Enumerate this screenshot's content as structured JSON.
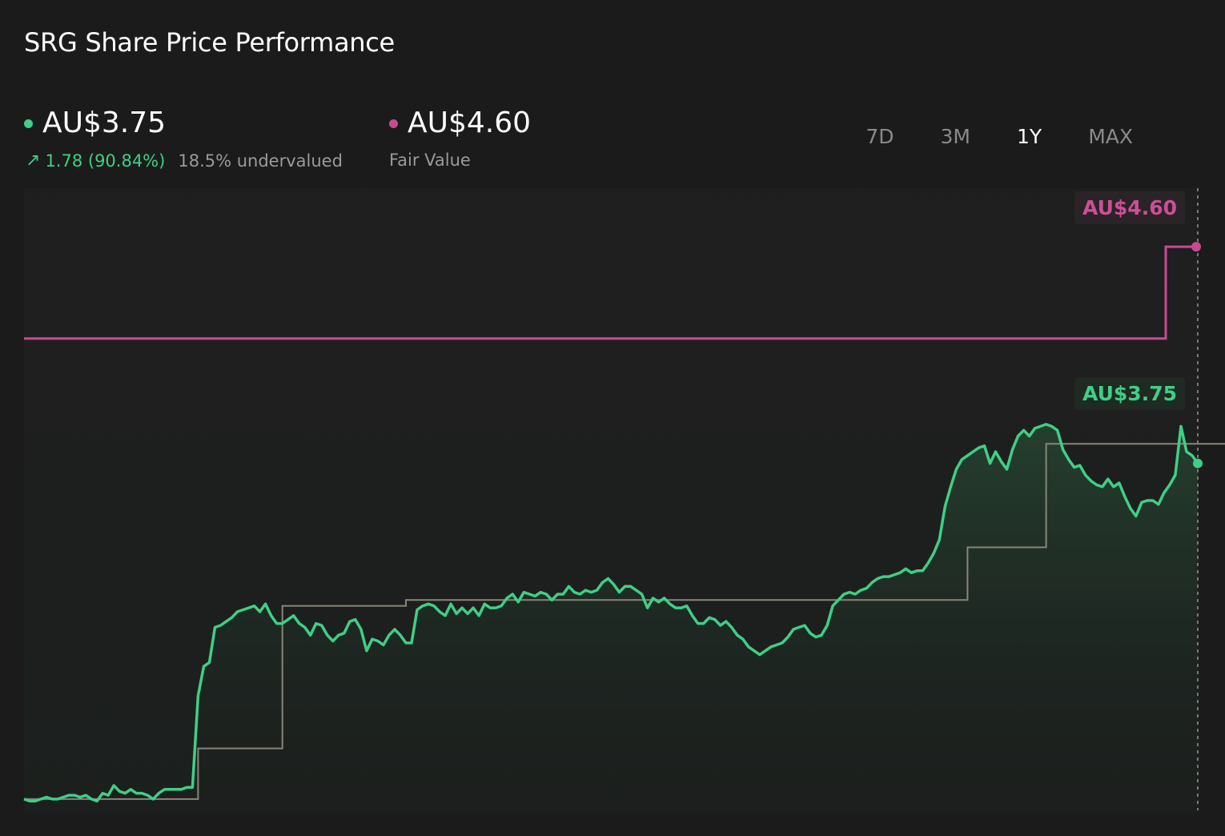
{
  "title": "SRG Share Price Performance",
  "price": {
    "value": "AU$3.75",
    "change": "1.78 (90.84%)",
    "valuation": "18.5% undervalued",
    "color": "#3fcf86",
    "arrow_icon": "arrow-up-right-icon"
  },
  "fair_value": {
    "value": "AU$4.60",
    "label": "Fair Value",
    "color": "#c94a93"
  },
  "tabs": [
    {
      "label": "7D",
      "active": false
    },
    {
      "label": "3M",
      "active": false
    },
    {
      "label": "1Y",
      "active": true
    },
    {
      "label": "MAX",
      "active": false
    }
  ],
  "chart_data": {
    "type": "line",
    "ylim": [
      1.7,
      4.9
    ],
    "price_series": [
      1.77,
      1.76,
      1.76,
      1.77,
      1.78,
      1.77,
      1.77,
      1.78,
      1.79,
      1.79,
      1.78,
      1.79,
      1.77,
      1.76,
      1.8,
      1.79,
      1.84,
      1.81,
      1.8,
      1.82,
      1.8,
      1.8,
      1.79,
      1.77,
      1.8,
      1.82,
      1.82,
      1.82,
      1.82,
      1.83,
      1.83,
      2.3,
      2.45,
      2.47,
      2.65,
      2.66,
      2.68,
      2.7,
      2.73,
      2.74,
      2.75,
      2.76,
      2.73,
      2.77,
      2.71,
      2.67,
      2.67,
      2.69,
      2.71,
      2.67,
      2.65,
      2.61,
      2.67,
      2.66,
      2.61,
      2.58,
      2.61,
      2.62,
      2.68,
      2.69,
      2.64,
      2.53,
      2.59,
      2.58,
      2.56,
      2.61,
      2.64,
      2.61,
      2.57,
      2.57,
      2.74,
      2.76,
      2.77,
      2.76,
      2.73,
      2.71,
      2.77,
      2.72,
      2.75,
      2.72,
      2.75,
      2.71,
      2.77,
      2.75,
      2.75,
      2.76,
      2.8,
      2.82,
      2.78,
      2.83,
      2.82,
      2.81,
      2.83,
      2.82,
      2.79,
      2.82,
      2.82,
      2.86,
      2.83,
      2.82,
      2.84,
      2.83,
      2.84,
      2.88,
      2.9,
      2.87,
      2.83,
      2.86,
      2.86,
      2.84,
      2.82,
      2.75,
      2.8,
      2.78,
      2.8,
      2.77,
      2.75,
      2.75,
      2.76,
      2.71,
      2.67,
      2.67,
      2.7,
      2.69,
      2.66,
      2.68,
      2.65,
      2.61,
      2.59,
      2.55,
      2.53,
      2.51,
      2.53,
      2.55,
      2.56,
      2.57,
      2.6,
      2.64,
      2.65,
      2.66,
      2.62,
      2.6,
      2.61,
      2.66,
      2.76,
      2.79,
      2.82,
      2.83,
      2.82,
      2.84,
      2.85,
      2.88,
      2.9,
      2.91,
      2.91,
      2.92,
      2.93,
      2.95,
      2.93,
      2.94,
      2.94,
      2.98,
      3.03,
      3.1,
      3.27,
      3.37,
      3.46,
      3.51,
      3.53,
      3.55,
      3.57,
      3.58,
      3.49,
      3.55,
      3.5,
      3.46,
      3.56,
      3.63,
      3.66,
      3.63,
      3.67,
      3.68,
      3.69,
      3.68,
      3.66,
      3.56,
      3.51,
      3.47,
      3.48,
      3.43,
      3.4,
      3.38,
      3.37,
      3.41,
      3.37,
      3.39,
      3.32,
      3.26,
      3.22,
      3.29,
      3.3,
      3.3,
      3.28,
      3.34,
      3.38,
      3.43,
      3.68,
      3.55,
      3.53,
      3.49
    ],
    "fair_value_series": [
      1.77,
      1.77,
      1.77,
      1.77,
      1.77,
      1.77,
      1.77,
      1.77,
      1.77,
      1.77,
      1.77,
      1.77,
      1.77,
      1.77,
      1.77,
      1.77,
      1.77,
      1.77,
      1.77,
      1.77,
      1.77,
      1.77,
      1.77,
      1.77,
      1.77,
      1.77,
      1.77,
      1.77,
      1.77,
      1.77,
      1.77,
      2.03,
      2.03,
      2.03,
      2.03,
      2.03,
      2.03,
      2.03,
      2.03,
      2.03,
      2.03,
      2.03,
      2.03,
      2.03,
      2.03,
      2.03,
      2.76,
      2.76,
      2.76,
      2.76,
      2.76,
      2.76,
      2.76,
      2.76,
      2.76,
      2.76,
      2.76,
      2.76,
      2.76,
      2.76,
      2.76,
      2.76,
      2.76,
      2.76,
      2.76,
      2.76,
      2.76,
      2.76,
      2.79,
      2.79,
      2.79,
      2.79,
      2.79,
      2.79,
      2.79,
      2.79,
      2.79,
      2.79,
      2.79,
      2.79,
      2.79,
      2.79,
      2.79,
      2.79,
      2.79,
      2.79,
      2.79,
      2.79,
      2.79,
      2.79,
      2.79,
      2.79,
      2.79,
      2.79,
      2.79,
      2.79,
      2.79,
      2.79,
      2.79,
      2.79,
      2.79,
      2.79,
      2.79,
      2.79,
      2.79,
      2.79,
      2.79,
      2.79,
      2.79,
      2.79,
      2.79,
      2.79,
      2.79,
      2.79,
      2.79,
      2.79,
      2.79,
      2.79,
      2.79,
      2.79,
      2.79,
      2.79,
      2.79,
      2.79,
      2.79,
      2.79,
      2.79,
      2.79,
      2.79,
      2.79,
      2.79,
      2.79,
      2.79,
      2.79,
      2.79,
      2.79,
      2.79,
      2.79,
      2.79,
      2.79,
      2.79,
      2.79,
      2.79,
      2.79,
      2.79,
      2.79,
      2.79,
      2.79,
      2.79,
      2.79,
      2.79,
      2.79,
      2.79,
      2.79,
      2.79,
      2.79,
      2.79,
      2.79,
      2.79,
      2.79,
      2.79,
      2.79,
      2.79,
      2.79,
      2.79,
      2.79,
      2.79,
      2.79,
      3.06,
      3.06,
      3.06,
      3.06,
      3.06,
      3.06,
      3.06,
      3.06,
      3.06,
      3.06,
      3.06,
      3.06,
      3.06,
      3.06,
      3.59,
      3.59,
      3.59,
      3.59,
      3.59,
      3.59,
      3.59,
      3.59,
      3.59,
      3.59,
      3.59,
      3.59,
      3.59,
      3.59,
      3.59,
      3.59,
      3.59,
      3.59,
      3.59,
      3.59,
      3.59,
      3.59,
      3.59,
      3.59,
      3.59,
      3.59,
      3.59,
      3.59,
      3.59,
      3.59,
      3.59,
      3.59,
      3.59,
      3.59,
      3.59,
      3.59,
      3.59,
      3.59
    ],
    "fair_value_line": [
      4.13,
      4.13,
      4.6
    ],
    "price_label": "AU$3.75",
    "fair_value_label": "AU$4.60",
    "grid": false
  }
}
